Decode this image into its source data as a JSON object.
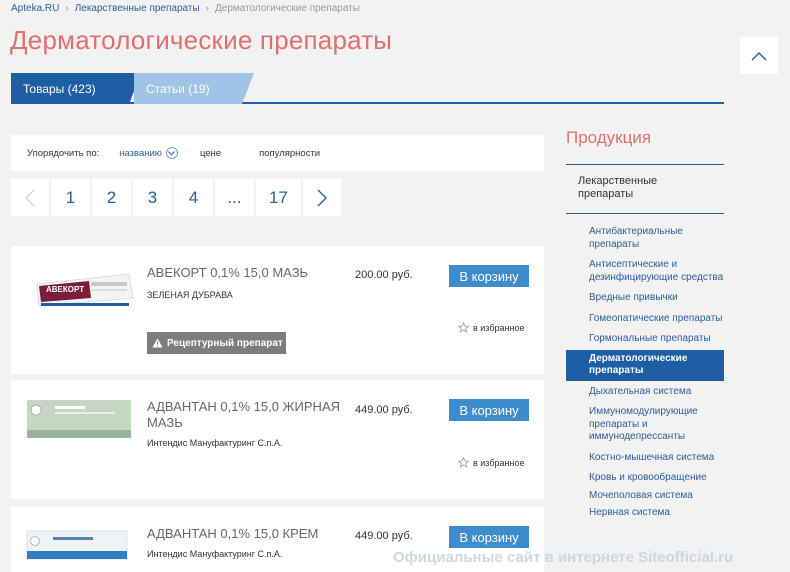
{
  "breadcrumb": {
    "items": [
      "Apteka.RU",
      "Лекарственные препараты",
      "Дерматологические препараты"
    ],
    "separator": "›"
  },
  "page": {
    "title": "Дерматологические препараты"
  },
  "tabs": [
    {
      "label": "Товары (423)",
      "active": true
    },
    {
      "label": "Статьи (19)",
      "active": false
    }
  ],
  "sort": {
    "label": "Упорядочить по:",
    "options": [
      "названию",
      "цене",
      "популярности"
    ]
  },
  "pager": {
    "pages": [
      "1",
      "2",
      "3",
      "4",
      "...",
      "17"
    ]
  },
  "products": [
    {
      "title": "АВЕКОРТ 0,1% 15,0 МАЗЬ",
      "maker": "ЗЕЛЕНАЯ ДУБРАВА",
      "price": "200.00 руб.",
      "cart": "В корзину",
      "fav": "в избранное",
      "rx": "Рецептурный препарат",
      "pack_label": "АВЕКОРТ"
    },
    {
      "title": "АДВАНТАН 0,1% 15,0 ЖИРНАЯ МАЗЬ",
      "maker": "Интендис Мануфактуринг С.п.А.",
      "price": "449.00 руб.",
      "cart": "В корзину",
      "fav": "в избранное"
    },
    {
      "title": "АДВАНТАН 0,1% 15,0 КРЕМ",
      "maker": "Интендис Мануфактуринг С.п.А.",
      "price": "449.00 руб.",
      "cart": "В корзину"
    }
  ],
  "sidebar": {
    "title": "Продукция",
    "parent": "Лекарственные препараты",
    "items": [
      {
        "label": "Антибактериальные препараты",
        "active": false
      },
      {
        "label": "Антисептические и дезинфицирующие средства",
        "active": false
      },
      {
        "label": "Вредные привычки",
        "active": false
      },
      {
        "label": "Гомеопатические препараты",
        "active": false
      },
      {
        "label": "Гормональные препараты",
        "active": false
      },
      {
        "label": "Дерматологические препараты",
        "active": true
      },
      {
        "label": "Дыхательная система",
        "active": false
      },
      {
        "label": "Иммуномодулирующие препараты и иммунодепрессанты",
        "active": false
      },
      {
        "label": "Костно-мышечная система",
        "active": false
      },
      {
        "label": "Кровь и кровообращение",
        "active": false
      },
      {
        "label": "Мочеполовая система",
        "active": false
      },
      {
        "label": "Нервная система",
        "active": false
      }
    ]
  },
  "watermark": "Официальные сайт в интернете Siteofficial.ru",
  "colors": {
    "brand_blue": "#1d5ea4",
    "title_red": "#e0706e",
    "cart_blue": "#3d8ccc",
    "link_blue": "#2a5e9c"
  }
}
